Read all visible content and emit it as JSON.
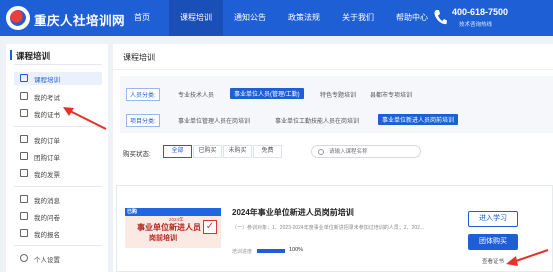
{
  "header": {
    "site_title": "重庆人社培训网",
    "nav": [
      "首页",
      "课程培训",
      "通知公告",
      "政策法规",
      "关于我们",
      "帮助中心"
    ],
    "active_nav": 1,
    "phone": "400-618-7500",
    "phone_sub": "技术咨询热线"
  },
  "sidebar": {
    "title": "课程培训",
    "items": [
      {
        "label": "课程培训",
        "icon": "book-icon",
        "active": true
      },
      {
        "label": "我的考试",
        "icon": "exam-icon"
      },
      {
        "label": "我的证书",
        "icon": "certificate-icon"
      },
      {
        "label": "我的订单",
        "icon": "order-icon"
      },
      {
        "label": "团购订单",
        "icon": "group-order-icon"
      },
      {
        "label": "我的发票",
        "icon": "invoice-icon"
      },
      {
        "label": "我的消息",
        "icon": "message-icon"
      },
      {
        "label": "我的问卷",
        "icon": "survey-icon"
      },
      {
        "label": "我的报名",
        "icon": "signup-icon"
      },
      {
        "label": "个人设置",
        "icon": "user-icon"
      }
    ]
  },
  "main": {
    "title": "课程培训",
    "filters": {
      "category_label": "人员分类:",
      "categories": [
        "专业技术人员",
        "事业单位人员(管理/工勤)",
        "特色专题培训",
        "县都市专项培训"
      ],
      "category_selected": 1,
      "project_label": "项目分类:",
      "projects": [
        "事业单位管理人员在岗培训",
        "事业单位工勤技能人员在岗培训",
        "事业单位新进人员岗前培训"
      ],
      "project_selected": 2
    },
    "purchase": {
      "label": "购买状态:",
      "tabs": [
        "全部",
        "已购买",
        "未购买",
        "免费"
      ],
      "selected": 0
    },
    "search": {
      "placeholder": "请输入课程名称"
    },
    "course": {
      "thumb_tag": "已购",
      "thumb_year": "2024年",
      "thumb_line1": "事业单位新进人员",
      "thumb_line2": "岗前培训",
      "title": "2024年事业单位新进人员岗前培训",
      "desc": "（一）参训对象：1、2023-2024年度事业单位新进招录未参加过培训的人员；2、202...",
      "progress_label": "培训进度",
      "progress_pct": 100,
      "progress_text": "100%",
      "btn_study": "进入学习",
      "btn_group": "团体购买",
      "cert_link": "查看证书"
    }
  },
  "colors": {
    "primary": "#1e5fd6",
    "arrow": "#e8312a"
  }
}
